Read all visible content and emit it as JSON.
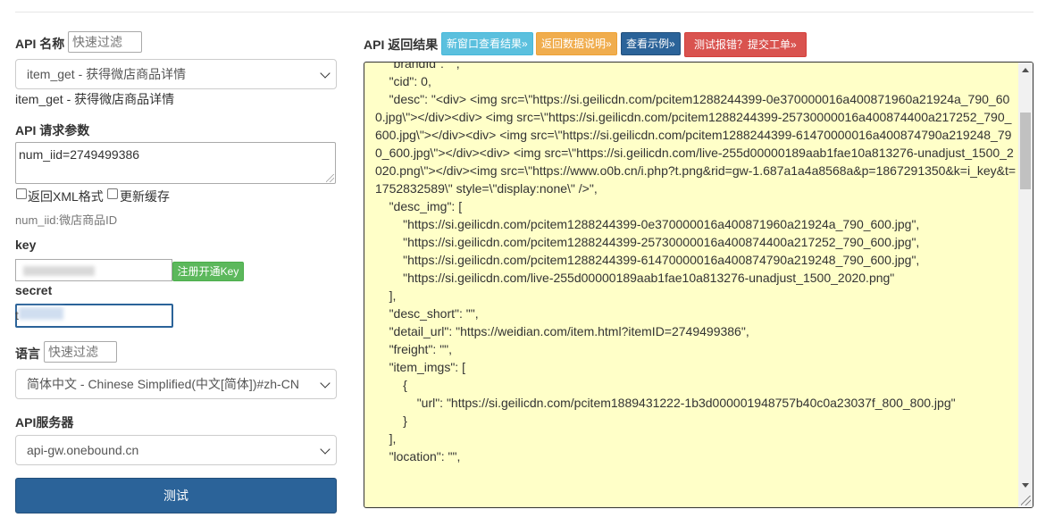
{
  "form": {
    "api_name_label": "API 名称",
    "api_filter_placeholder": "快速过滤",
    "api_select_value": "item_get - 获得微店商品详情",
    "api_selected_text": "item_get - 获得微店商品详情",
    "params_label": "API 请求参数",
    "params_value": "num_iid=2749499386",
    "xml_checkbox_label": "返回XML格式",
    "cache_checkbox_label": "更新缓存",
    "param_hint": "num_iid:微店商品ID",
    "key_label": "key",
    "register_key_button": "注册开通Key",
    "secret_label": "secret",
    "secret_value": "t",
    "lang_label": "语言",
    "lang_filter_placeholder": "快速过滤",
    "lang_select_value": "简体中文 - Chinese Simplified(中文[简体])#zh-CN",
    "server_label": "API服务器",
    "server_select_value": "api-gw.onebound.cn",
    "submit_button": "测试"
  },
  "result": {
    "label": "API 返回结果",
    "buttons": [
      {
        "label": "新窗口查看结果»",
        "color": "#5bc0de"
      },
      {
        "label": "返回数据说明»",
        "color": "#f0ad4e"
      },
      {
        "label": "查看示例»",
        "color": "#2b6399"
      },
      {
        "label": "测试报错？提交工单»",
        "color": "#d9534f"
      }
    ],
    "json_text": "\t\"brandId\": \"\",\n\t\"cid\": 0,\n\t\"desc\": \"<div> <img src=\\\"https://si.geilicdn.com/pcitem1288244399-0e370000016a400871960a21924a_790_600.jpg\\\"></div><div> <img src=\\\"https://si.geilicdn.com/pcitem1288244399-25730000016a400874400a217252_790_600.jpg\\\"></div><div> <img src=\\\"https://si.geilicdn.com/pcitem1288244399-61470000016a400874790a219248_790_600.jpg\\\"></div><div> <img src=\\\"https://si.geilicdn.com/live-255d00000189aab1fae10a813276-unadjust_1500_2020.png\\\"></div><img src=\\\"https://www.o0b.cn/i.php?t.png&rid=gw-1.687a1a4a8568a&p=1867291350&k=i_key&t=1752832589\\\" style=\\\"display:none\\\" />\",\n\t\"desc_img\": [\n\t\t\"https://si.geilicdn.com/pcitem1288244399-0e370000016a400871960a21924a_790_600.jpg\",\n\t\t\"https://si.geilicdn.com/pcitem1288244399-25730000016a400874400a217252_790_600.jpg\",\n\t\t\"https://si.geilicdn.com/pcitem1288244399-61470000016a400874790a219248_790_600.jpg\",\n\t\t\"https://si.geilicdn.com/live-255d00000189aab1fae10a813276-unadjust_1500_2020.png\"\n\t],\n\t\"desc_short\": \"\",\n\t\"detail_url\": \"https://weidian.com/item.html?itemID=2749499386\",\n\t\"freight\": \"\",\n\t\"item_imgs\": [\n\t\t{\n\t\t\t\"url\": \"https://si.geilicdn.com/pcitem1889431222-1b3d000001948757b40c0a23037f_800_800.jpg\"\n\t\t}\n\t],\n\t\"location\": \"\","
  }
}
